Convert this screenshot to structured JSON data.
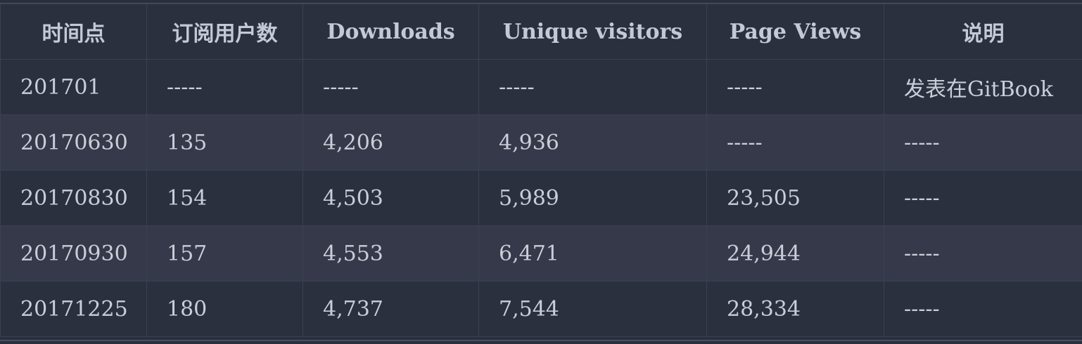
{
  "table": {
    "headers": [
      "时间点",
      "订阅用户数",
      "Downloads",
      "Unique visitors",
      "Page Views",
      "说明"
    ],
    "rows": [
      [
        "201701",
        "-----",
        "-----",
        "-----",
        "-----",
        "发表在GitBook"
      ],
      [
        "20170630",
        "135",
        "4,206",
        "4,936",
        "-----",
        "-----"
      ],
      [
        "20170830",
        "154",
        "4,503",
        "5,989",
        "23,505",
        "-----"
      ],
      [
        "20170930",
        "157",
        "4,553",
        "6,471",
        "24,944",
        "-----"
      ],
      [
        "20171225",
        "180",
        "4,737",
        "7,544",
        "28,334",
        "-----"
      ]
    ]
  },
  "colors": {
    "background": "#2a2f3d",
    "row_alt": "#353949",
    "text": "#c9ced9",
    "border": "#3b4152"
  }
}
